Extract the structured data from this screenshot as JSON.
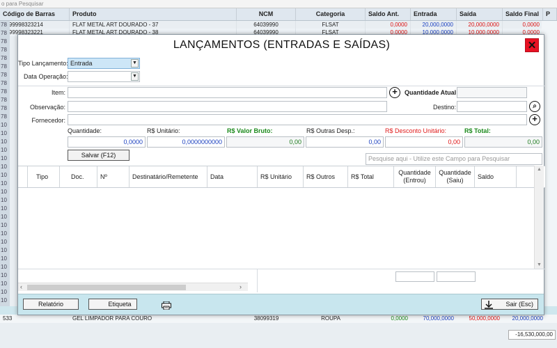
{
  "background": {
    "search_placeholder": "o para Pesquisar",
    "columns": [
      "Código de Barras",
      "Produto",
      "NCM",
      "Categoria",
      "Saldo Ant.",
      "Entrada",
      "Saída",
      "Saldo Final",
      "P"
    ],
    "row_first": {
      "barcode": "7899998323214",
      "product": "FLAT METAL ART DOURADO - 37",
      "ncm": "64039990",
      "category": "FLSAT",
      "saldo_ant": "0,0000",
      "entrada": "20,000,0000",
      "saida": "20,000,0000",
      "saldo_final": "0,0000"
    },
    "row_second": {
      "barcode": "7899998323221",
      "product": "FLAT METAL ART DOURADO - 38",
      "ncm": "64039990",
      "category": "FLSAT",
      "saldo_ant": "0,0000",
      "entrada": "10,000,0000",
      "saida": "10,000,0000",
      "saldo_final": "0,0000"
    },
    "left_codes": [
      "78",
      "78",
      "78",
      "78",
      "78",
      "78",
      "78",
      "78",
      "78",
      "78",
      "78",
      "78",
      "10",
      "10",
      "10",
      "10",
      "10",
      "10",
      "10",
      "10",
      "10",
      "10",
      "10",
      "10",
      "10",
      "10",
      "10",
      "10",
      "10",
      "10",
      "10",
      "10",
      "10",
      "10"
    ],
    "row_bottom": {
      "barcode": "533",
      "product": "GEL LIMPADOR PARA COURO",
      "ncm": "38099319",
      "category": "ROUPA",
      "saldo_ant": "0,0000",
      "entrada": "70,000,0000",
      "saida": "50,000,0000",
      "saldo_final": "20,000,0000"
    },
    "total": "-16,530,000,00"
  },
  "dialog": {
    "title": "LANÇAMENTOS (ENTRADAS E SAÍDAS)",
    "close_label": "✕",
    "tipo_lancamento_label": "Tipo Lançamento:",
    "tipo_lancamento_value": "Entrada",
    "data_operacao_label": "Data Operação:",
    "data_operacao_value": "",
    "item_label": "Item:",
    "quantidade_atual_label": "Quantidade Atual:",
    "observacao_label": "Observação:",
    "destino_label": "Destino:",
    "fornecedor_label": "Fornecedor:",
    "quantidade_label": "Quantidade:",
    "quantidade_value": "0,0000",
    "unitario_label": "R$ Unitário:",
    "unitario_value": "0,0000000000",
    "valor_bruto_label": "R$ Valor Bruto:",
    "valor_bruto_value": "0,00",
    "outras_desp_label": "R$ Outras Desp.:",
    "outras_desp_value": "0,00",
    "desconto_label": "R$ Desconto Unitário:",
    "desconto_value": "0,00",
    "total_label": "R$ Total:",
    "total_value": "0,00",
    "salvar_label": "Salvar (F12)",
    "search_placeholder": "Pesquise aqui - Utilize este Campo para Pesquisar",
    "grid_columns": {
      "tipo": "Tipo",
      "doc": "Doc.",
      "num": "Nº",
      "destinatario": "Destinatário/Remetente",
      "data": "Data",
      "unitario": "R$ Unitário",
      "outros": "R$ Outros",
      "total": "R$ Total",
      "qtd_entrou_1": "Quantidade",
      "qtd_entrou_2": "(Entrou)",
      "qtd_saiu_1": "Quantidade",
      "qtd_saiu_2": "(Saiu)",
      "saldo": "Saldo"
    },
    "relatorio_label": "Relatório",
    "etiqueta_label": "Etiqueta",
    "sair_label": "Sair (Esc)"
  }
}
